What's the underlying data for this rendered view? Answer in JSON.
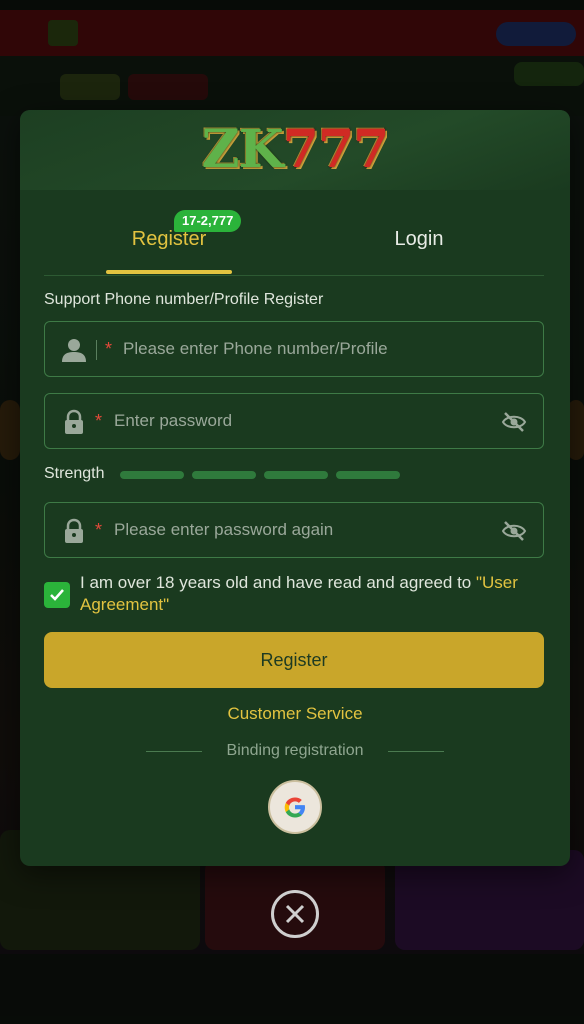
{
  "logo": {
    "text_zk": "ZK",
    "text_num": "777"
  },
  "tabs": [
    {
      "label": "Register",
      "badge": "17-2,777",
      "active": true
    },
    {
      "label": "Login",
      "active": false
    }
  ],
  "form": {
    "section_label": "Support Phone number/Profile Register",
    "required_mark": "*",
    "fields": {
      "account": {
        "placeholder": "Please enter Phone number/Profile",
        "icon": "user-icon"
      },
      "password": {
        "placeholder": "Enter password",
        "icon": "lock-icon",
        "toggle_icon": "eye-off-icon"
      },
      "confirm_password": {
        "placeholder": "Please enter password again",
        "icon": "lock-icon",
        "toggle_icon": "eye-off-icon"
      }
    },
    "strength_label": "Strength",
    "strength_segments": 4,
    "agreement": {
      "checked": true,
      "text": "I am over 18 years old and have read and agreed to ",
      "link_text": "\"User Agreement\""
    },
    "submit_label": "Register"
  },
  "customer_service_label": "Customer Service",
  "binding_label": "Binding registration",
  "social": {
    "google_icon": "google-icon"
  },
  "close_icon": "close-icon",
  "colors": {
    "accent_gold": "#e2c340",
    "button_gold": "#c9a62a",
    "modal_bg": "#1a3a1f",
    "badge_green": "#2bb33a",
    "required_red": "#e34a3a"
  }
}
